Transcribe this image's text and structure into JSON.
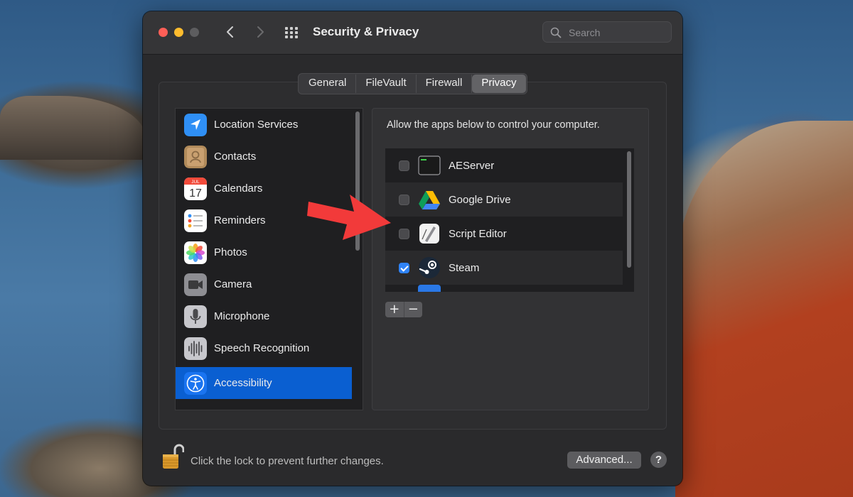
{
  "window": {
    "title": "Security & Privacy"
  },
  "search": {
    "placeholder": "Search"
  },
  "tabs": [
    {
      "label": "General",
      "active": false
    },
    {
      "label": "FileVault",
      "active": false
    },
    {
      "label": "Firewall",
      "active": false
    },
    {
      "label": "Privacy",
      "active": true
    }
  ],
  "sidebar": {
    "items": [
      {
        "label": "Location Services",
        "icon": "location-arrow-icon",
        "selected": false
      },
      {
        "label": "Contacts",
        "icon": "contacts-book-icon",
        "selected": false
      },
      {
        "label": "Calendars",
        "icon": "calendar-icon",
        "selected": false,
        "icon_text": {
          "month": "JUL",
          "day": "17"
        }
      },
      {
        "label": "Reminders",
        "icon": "reminders-list-icon",
        "selected": false
      },
      {
        "label": "Photos",
        "icon": "photos-flower-icon",
        "selected": false
      },
      {
        "label": "Camera",
        "icon": "camera-icon",
        "selected": false
      },
      {
        "label": "Microphone",
        "icon": "microphone-icon",
        "selected": false
      },
      {
        "label": "Speech Recognition",
        "icon": "waveform-icon",
        "selected": false
      },
      {
        "label": "Accessibility",
        "icon": "accessibility-person-icon",
        "selected": true
      }
    ]
  },
  "panel": {
    "description": "Allow the apps below to control your computer.",
    "apps": [
      {
        "label": "AEServer",
        "icon": "terminal-icon",
        "checked": false
      },
      {
        "label": "Google Drive",
        "icon": "google-drive-icon",
        "checked": false
      },
      {
        "label": "Script Editor",
        "icon": "script-editor-icon",
        "checked": false
      },
      {
        "label": "Steam",
        "icon": "steam-icon",
        "checked": true
      }
    ],
    "add_label": "+",
    "remove_label": "−"
  },
  "footer": {
    "lock_text": "Click the lock to prevent further changes.",
    "advanced_label": "Advanced...",
    "help_label": "?"
  },
  "colors": {
    "selection_blue": "#0a5fd1",
    "checkbox_blue": "#2f83f7",
    "annotation_red": "#f23a3a"
  }
}
